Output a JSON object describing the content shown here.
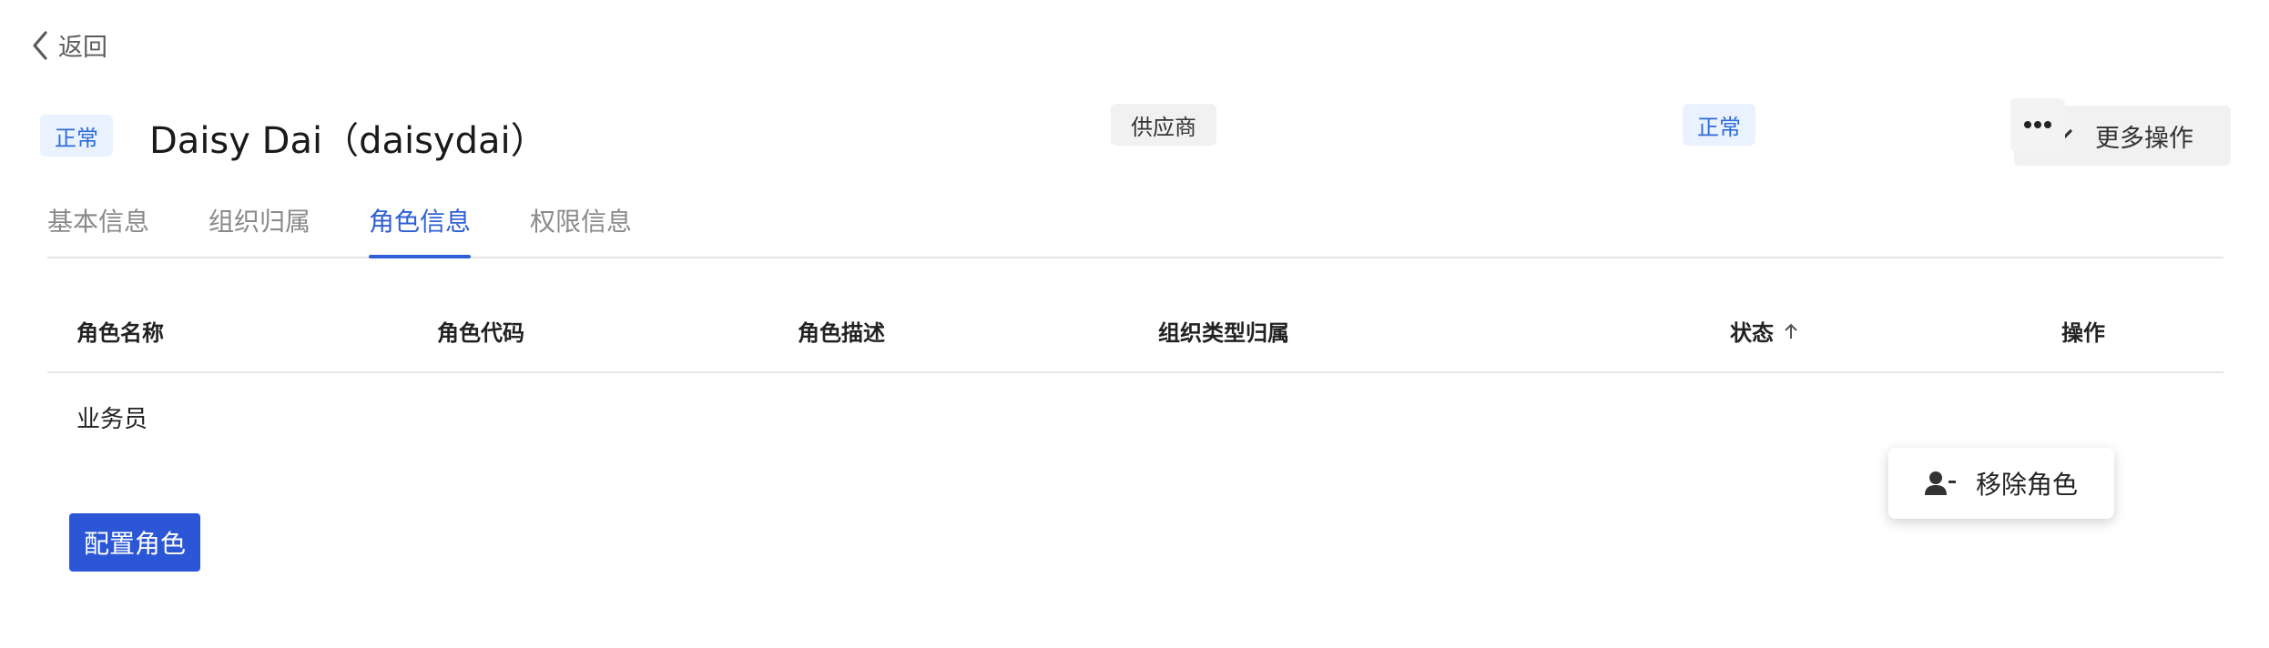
{
  "nav": {
    "back_label": "返回"
  },
  "header": {
    "status_tag": "正常",
    "title": "Daisy Dai（daisydai）",
    "more_actions_label": "更多操作"
  },
  "tabs": [
    {
      "label": "基本信息",
      "active": false
    },
    {
      "label": "组织归属",
      "active": false
    },
    {
      "label": "角色信息",
      "active": true
    },
    {
      "label": "权限信息",
      "active": false
    }
  ],
  "table": {
    "columns": [
      "角色名称",
      "角色代码",
      "角色描述",
      "组织类型归属",
      "状态",
      "操作"
    ],
    "sort": {
      "column": "状态",
      "direction": "ascending"
    },
    "rows": [
      {
        "role_name": "业务员",
        "role_code": "",
        "role_desc": "",
        "org_type": "供应商",
        "status": "正常"
      }
    ]
  },
  "row_menu": {
    "items": [
      {
        "label": "移除角色",
        "icon": "user-minus-icon"
      }
    ]
  },
  "primary_action": {
    "label": "配置角色"
  },
  "colors": {
    "accent": "#2b57d6",
    "status_bg": "#eaf2ff",
    "status_text": "#2f6bd8"
  }
}
